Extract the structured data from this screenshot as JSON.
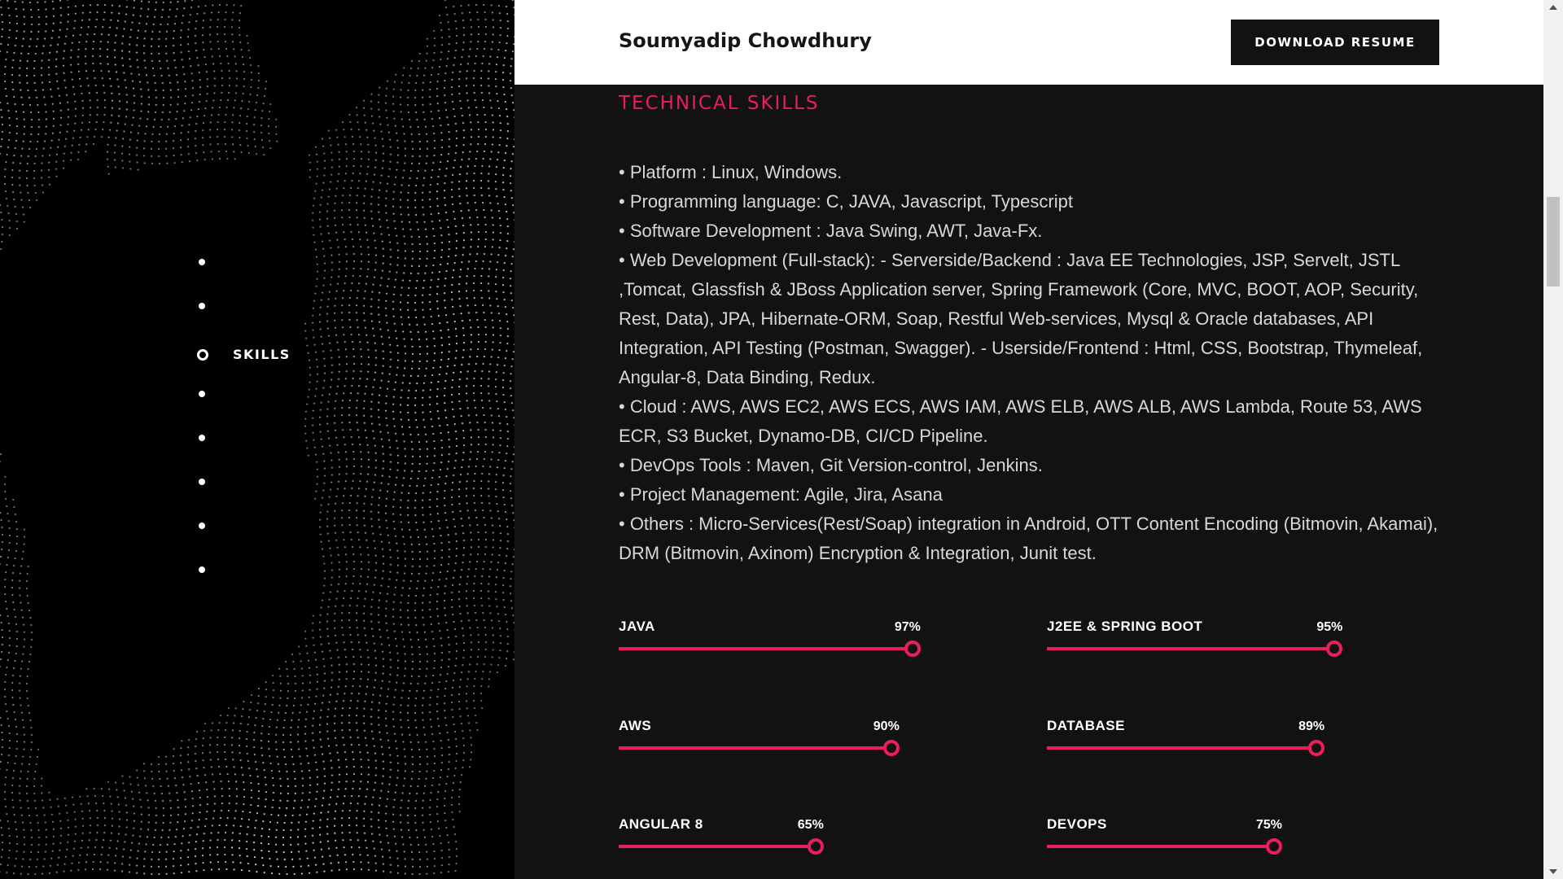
{
  "header": {
    "brand": "Soumyadip Chowdhury",
    "download_label": "DOWNLOAD RESUME"
  },
  "nav": {
    "active_label": "SKILLS",
    "items": [
      "",
      "",
      "SKILLS",
      "",
      "",
      "",
      "",
      ""
    ]
  },
  "skills": {
    "title": "TECHNICAL SKILLS",
    "lines": [
      "• Platform : Linux, Windows.",
      "• Programming language: C, JAVA, Javascript, Typescript",
      "• Software Development : Java Swing, AWT, Java-Fx.",
      "• Web Development (Full-stack): - Serverside/Backend : Java EE Technologies, JSP, Servelt, JSTL ,Tomcat, Glassfish & JBoss Application server, Spring Framework (Core, MVC, BOOT, AOP, Security, Rest, Data), JPA, Hibernate-ORM, Soap, Restful Web-services, Mysql & Oracle databases, API Integration, API Testing (Postman, Swagger). - Userside/Frontend : Html, CSS, Bootstrap, Thymeleaf, Angular-8, Data Binding, Redux.",
      "• Cloud : AWS, AWS EC2, AWS ECS, AWS IAM, AWS ELB, AWS ALB, AWS Lambda, Route 53, AWS ECR, S3 Bucket, Dynamo-DB, CI/CD Pipeline.",
      "• DevOps Tools : Maven, Git Version-control, Jenkins.",
      "• Project Management: Agile, Jira, Asana",
      "• Others : Micro-Services(Rest/Soap) integration in Android, OTT Content Encoding (Bitmovin, Akamai), DRM (Bitmovin, Axinom) Encryption & Integration, Junit test."
    ],
    "bars": [
      {
        "name": "JAVA",
        "percent": 97,
        "percent_label": "97%"
      },
      {
        "name": "J2EE & SPRING BOOT",
        "percent": 95,
        "percent_label": "95%"
      },
      {
        "name": "AWS",
        "percent": 90,
        "percent_label": "90%"
      },
      {
        "name": "DATABASE",
        "percent": 89,
        "percent_label": "89%"
      },
      {
        "name": "ANGULAR 8",
        "percent": 65,
        "percent_label": "65%"
      },
      {
        "name": "DEVOPS",
        "percent": 75,
        "percent_label": "75%"
      }
    ]
  },
  "colors": {
    "accent": "#e91e5a",
    "content_bg": "#121213",
    "left_bg": "#000000"
  },
  "icons": {
    "nav_dot": "circle-dot-icon",
    "scroll_up": "arrow-up-icon",
    "scroll_down": "arrow-down-icon"
  }
}
